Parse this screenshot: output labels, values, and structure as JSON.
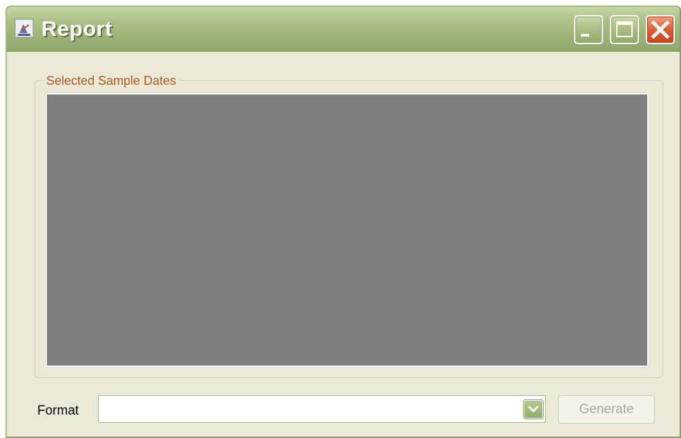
{
  "window": {
    "title": "Report",
    "icon": "java-app-icon",
    "controls": {
      "minimize_icon": "minimize-icon",
      "maximize_icon": "maximize-icon",
      "close_icon": "close-icon"
    }
  },
  "sample_dates": {
    "group_label": "Selected Sample Dates",
    "items": []
  },
  "format": {
    "label": "Format",
    "selected_value": "",
    "options": []
  },
  "generate": {
    "label": "Generate",
    "enabled": false
  },
  "colors": {
    "title_bar": "#a3ba7e",
    "group_label": "#b4581c",
    "list_background": "#7e7e7e",
    "close_button": "#e0623a"
  }
}
